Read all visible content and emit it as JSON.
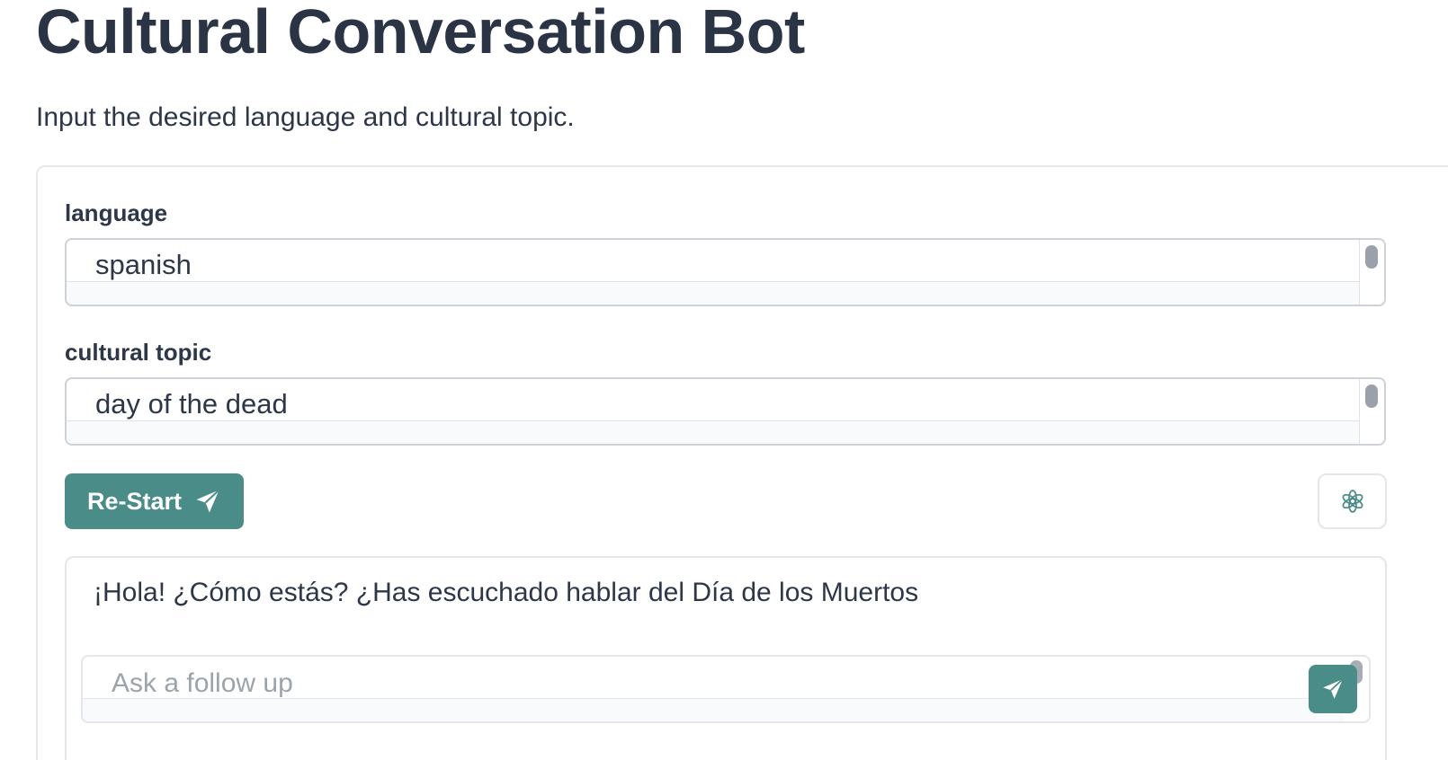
{
  "header": {
    "title": "Cultural Conversation Bot",
    "subtitle": "Input the desired language and cultural topic."
  },
  "form": {
    "language": {
      "label": "language",
      "value": "spanish"
    },
    "cultural_topic": {
      "label": "cultural topic",
      "value": "day of the dead"
    },
    "restart_label": "Re-Start",
    "restart_icon": "send-icon",
    "model_icon": "openai-icon"
  },
  "chat": {
    "bot_message": "¡Hola! ¿Cómo estás? ¿Has escuchado hablar del Día de los Muertos",
    "followup_placeholder": "Ask a follow up",
    "followup_value": "",
    "send_icon": "send-icon"
  },
  "colors": {
    "accent": "#4a8c87",
    "title": "#2b3445",
    "text": "#2d3748",
    "border": "#e3e6ea",
    "placeholder": "#9aa3ae"
  }
}
